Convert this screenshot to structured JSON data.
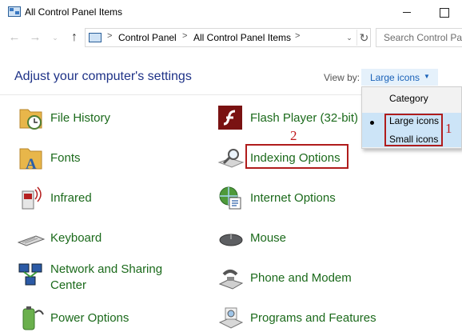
{
  "window": {
    "title": "All Control Panel Items"
  },
  "navigation": {
    "back_glyph": "←",
    "forward_glyph": "→",
    "recent_glyph": "⌄",
    "up_glyph": "↑",
    "breadcrumb": [
      "Control Panel",
      "All Control Panel Items"
    ],
    "separator": ">",
    "dropdown_glyph": "⌄",
    "refresh_glyph": "↻",
    "search_placeholder": "Search Control Pa"
  },
  "header": {
    "title": "Adjust your computer's settings",
    "view_by_label": "View by:",
    "view_by_value": "Large icons",
    "view_by_caret": "▼"
  },
  "view_menu": {
    "options": [
      "Category",
      "Large icons",
      "Small icons"
    ],
    "selected": "Large icons",
    "highlighted": "Small icons"
  },
  "items": [
    {
      "label": "File History",
      "icon": "file-history-icon"
    },
    {
      "label": "Flash Player (32-bit)",
      "icon": "flash-player-icon"
    },
    {
      "label": "Fonts",
      "icon": "fonts-icon"
    },
    {
      "label": "Indexing Options",
      "icon": "indexing-options-icon"
    },
    {
      "label": "Infrared",
      "icon": "infrared-icon"
    },
    {
      "label": "Internet Options",
      "icon": "internet-options-icon"
    },
    {
      "label": "Keyboard",
      "icon": "keyboard-icon"
    },
    {
      "label": "Mouse",
      "icon": "mouse-icon"
    },
    {
      "label": "Network and Sharing Center",
      "icon": "network-sharing-icon"
    },
    {
      "label": "Phone and Modem",
      "icon": "phone-modem-icon"
    },
    {
      "label": "Power Options",
      "icon": "power-options-icon"
    },
    {
      "label": "Programs and Features",
      "icon": "programs-features-icon"
    }
  ],
  "annotations": {
    "step1": "1",
    "step2": "2"
  },
  "colors": {
    "heading": "#1e3287",
    "item_link": "#1b6a1b",
    "annotation": "#c0181b",
    "menu_highlight": "#cce4f7"
  }
}
